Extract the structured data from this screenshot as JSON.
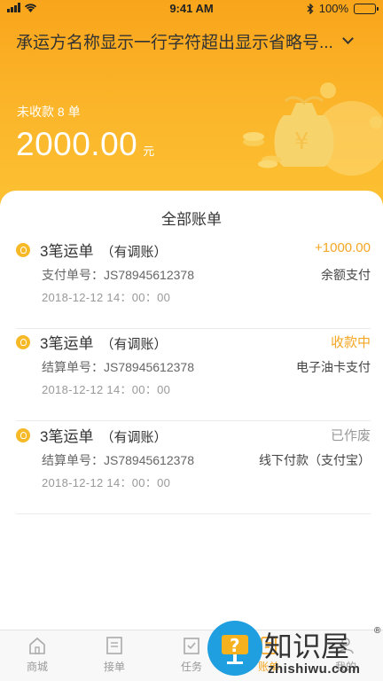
{
  "status_bar": {
    "time": "9:41 AM",
    "battery": "100%"
  },
  "header": {
    "carrier_name": "承运方名称显示一行字符超出显示省略号...",
    "unpaid_label": "未收款 8 单",
    "amount": "2000.00",
    "amount_unit": "元"
  },
  "panel": {
    "title": "全部账单",
    "bills": [
      {
        "title": "3笔运单",
        "tag": "（有调账）",
        "status": "+1000.00",
        "status_color": "#f5a623",
        "line1": "支付单号：JS78945612378",
        "right": "余额支付",
        "date": "2018-12-12  14：00：00"
      },
      {
        "title": "3笔运单",
        "tag": "（有调账）",
        "status": "收款中",
        "status_color": "#f5a623",
        "line1": "结算单号：JS78945612378",
        "right": "电子油卡支付",
        "date": "2018-12-12  14：00：00"
      },
      {
        "title": "3笔运单",
        "tag": "（有调账）",
        "status": "已作废",
        "status_color": "#999999",
        "line1": "结算单号：JS78945612378",
        "right": "线下付款（支付宝）",
        "date": "2018-12-12  14：00：00"
      }
    ]
  },
  "tabbar": {
    "tabs": [
      {
        "label": "商城",
        "icon": "home-icon"
      },
      {
        "label": "接单",
        "icon": "document-icon"
      },
      {
        "label": "任务",
        "icon": "task-check-icon"
      },
      {
        "label": "账单",
        "icon": "bill-icon"
      },
      {
        "label": "我的",
        "icon": "profile-icon"
      }
    ]
  },
  "watermark": {
    "text": "知识屋",
    "sub": "zhishiwu.com",
    "reg": "®"
  },
  "colors": {
    "accent": "#f5a623",
    "header_top": "#f9a51b",
    "header_bottom": "#fcc233"
  }
}
